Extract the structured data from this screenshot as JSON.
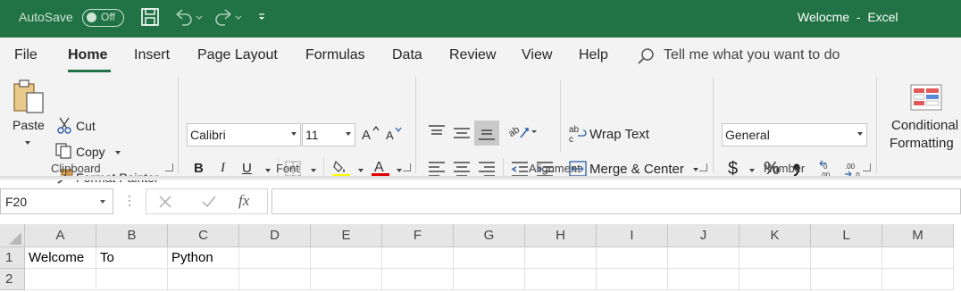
{
  "titlebar": {
    "autosave_label": "AutoSave",
    "autosave_state": "Off",
    "doc_title": "Welocme  -  Excel"
  },
  "tabs": [
    "File",
    "Home",
    "Insert",
    "Page Layout",
    "Formulas",
    "Data",
    "Review",
    "View",
    "Help"
  ],
  "active_tab": "Home",
  "tell_me": "Tell me what you want to do",
  "clipboard": {
    "group_label": "Clipboard",
    "paste": "Paste",
    "cut": "Cut",
    "copy": "Copy",
    "format_painter": "Format Painter"
  },
  "font": {
    "group_label": "Font",
    "font_name": "Calibri",
    "font_size": "11",
    "bold": "B",
    "italic": "I",
    "underline": "U",
    "font_color_glyph": "A",
    "highlight_color": "#ffff00",
    "font_color": "#e00000"
  },
  "alignment": {
    "group_label": "Alignment",
    "wrap_text": "Wrap Text",
    "merge_center": "Merge & Center"
  },
  "number": {
    "group_label": "Number",
    "format": "General",
    "currency": "$",
    "percent": "%",
    "comma": "̓"
  },
  "styles": {
    "conditional_line1": "Conditional",
    "conditional_line2": "Formatting"
  },
  "formula_bar": {
    "name_box": "F20",
    "fx": "fx",
    "formula": ""
  },
  "sheet": {
    "columns": [
      "A",
      "B",
      "C",
      "D",
      "E",
      "F",
      "G",
      "H",
      "I",
      "J",
      "K",
      "L",
      "M"
    ],
    "rows": [
      {
        "num": "1",
        "cells": [
          "Welcome",
          "To",
          "Python",
          "",
          "",
          "",
          "",
          "",
          "",
          "",
          "",
          "",
          ""
        ]
      },
      {
        "num": "2",
        "cells": [
          "",
          "",
          "",
          "",
          "",
          "",
          "",
          "",
          "",
          "",
          "",
          "",
          ""
        ]
      }
    ]
  },
  "colors": {
    "titlebar": "#217346",
    "ribbon": "#f3f3f3",
    "accent": "#217346"
  }
}
